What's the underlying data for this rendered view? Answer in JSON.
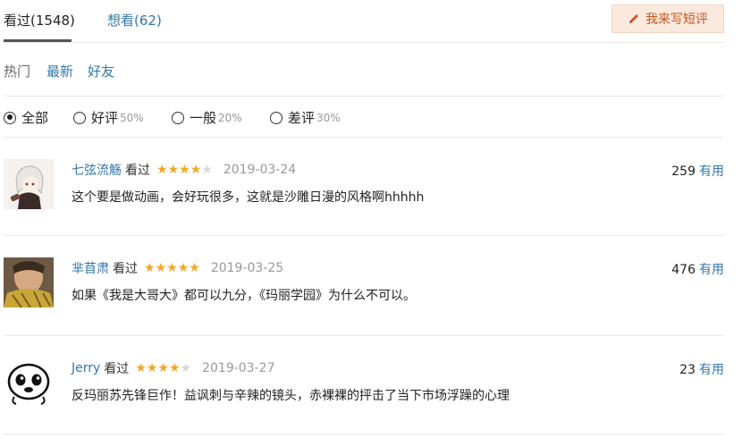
{
  "tabs": {
    "watched": "看过(1548)",
    "want": "想看(62)",
    "write_button": "我来写短评"
  },
  "sort": {
    "hot": "热门",
    "newest": "最新",
    "friends": "好友"
  },
  "filter": {
    "options": [
      {
        "label": "全部",
        "pct": "",
        "selected": true
      },
      {
        "label": "好评",
        "pct": "50%",
        "selected": false
      },
      {
        "label": "一般",
        "pct": "20%",
        "selected": false
      },
      {
        "label": "差评",
        "pct": "30%",
        "selected": false
      }
    ]
  },
  "comments": [
    {
      "user": "七弦流觞",
      "status": "看过",
      "rating": 4,
      "date": "2019-03-24",
      "votes": "259",
      "useful": "有用",
      "text": "这个要是做动画，会好玩很多，这就是沙雕日漫的风格啊hhhhh",
      "avatar": "girl-anime-avatar"
    },
    {
      "user": "芈苜肃",
      "status": "看过",
      "rating": 5,
      "date": "2019-03-25",
      "votes": "476",
      "useful": "有用",
      "text": "如果《我是大哥大》都可以九分，《玛丽学园》为什么不可以。",
      "avatar": "man-scarf-avatar"
    },
    {
      "user": "Jerry",
      "status": "看过",
      "rating": 4,
      "date": "2019-03-27",
      "votes": "23",
      "useful": "有用",
      "text": "反玛丽苏先锋巨作！益讽刺与辛辣的镜头，赤裸裸的抨击了当下市场浮躁的心理",
      "avatar": "meme-face-avatar"
    }
  ],
  "colors": {
    "link": "#3377aa",
    "star": "#f5a623",
    "button_bg": "#fbe9de",
    "button_text": "#c9561e"
  }
}
